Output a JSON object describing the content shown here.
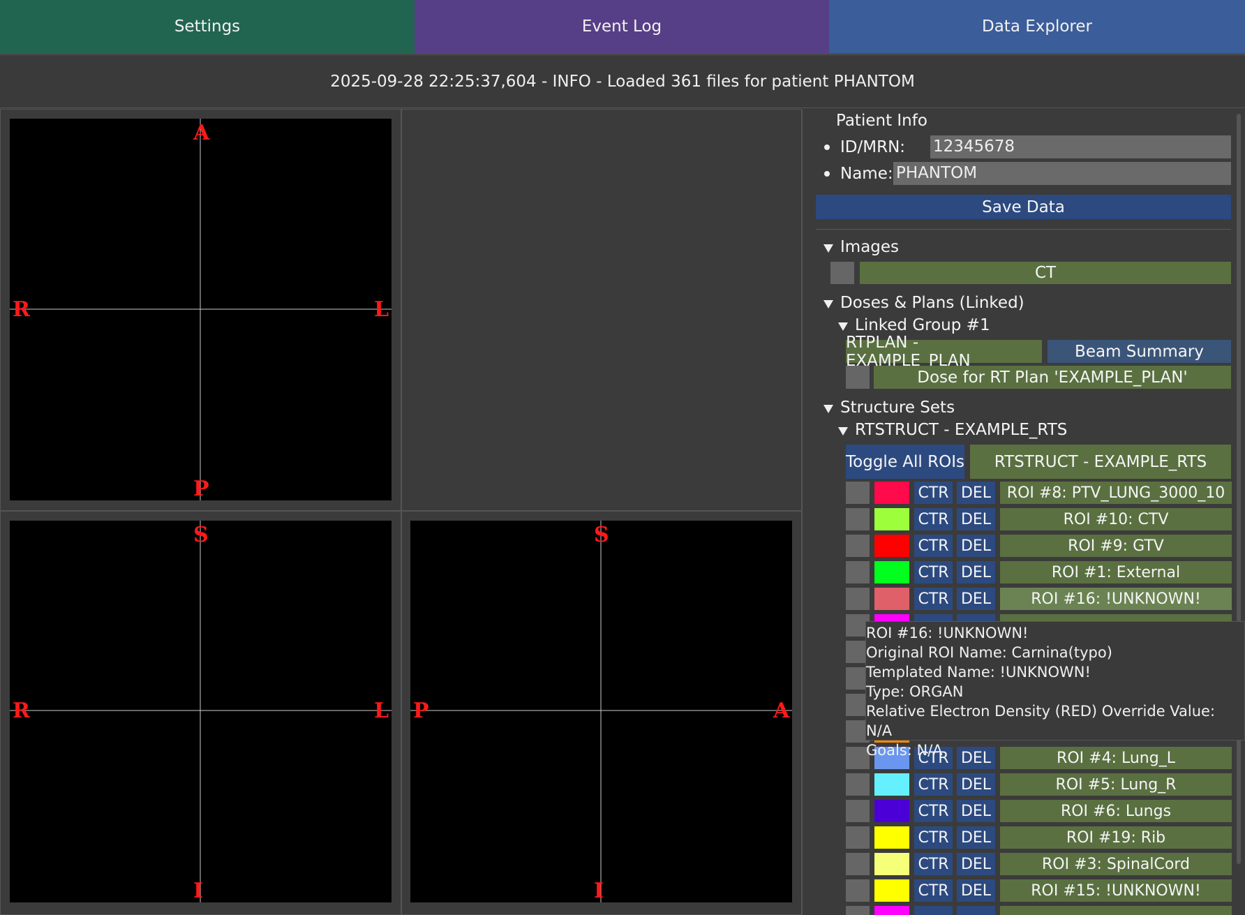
{
  "tabs": {
    "settings": "Settings",
    "event_log": "Event Log",
    "data_explorer": "Data Explorer"
  },
  "colors": {
    "settings_tab": "#216550",
    "event_log_tab": "#573f87",
    "data_explorer_tab": "#3b5d9a",
    "orientation_label": "#ff1a1a"
  },
  "log_message": "2025-09-28 22:25:37,604 - INFO - Loaded 361 files for patient PHANTOM",
  "views": {
    "axial": {
      "top": "A",
      "bottom": "P",
      "left": "R",
      "right": "L"
    },
    "coronal": {
      "top": "S",
      "bottom": "I",
      "left": "R",
      "right": "L"
    },
    "sagittal": {
      "top": "S",
      "bottom": "I",
      "left": "P",
      "right": "A"
    }
  },
  "patient_info": {
    "header": "Patient Info",
    "id_label": "ID/MRN:",
    "id_value": "12345678",
    "name_label": "Name:",
    "name_value": "PHANTOM",
    "save_button": "Save Data"
  },
  "images": {
    "header": "Images",
    "items": [
      "CT"
    ]
  },
  "doses_plans": {
    "header": "Doses & Plans (Linked)",
    "group_label": "Linked Group #1",
    "plan_button": "RTPLAN - EXAMPLE_PLAN",
    "beam_summary_button": "Beam Summary",
    "dose_button": "Dose for RT Plan 'EXAMPLE_PLAN'"
  },
  "structure_sets": {
    "header": "Structure Sets",
    "rtstruct_label": "RTSTRUCT - EXAMPLE_RTS",
    "toggle_all_button": "Toggle All ROIs",
    "rtstruct_button": "RTSTRUCT - EXAMPLE_RTS",
    "ctr_label": "CTR",
    "del_label": "DEL",
    "rois_top": [
      {
        "name": "ROI #8: PTV_LUNG_3000_10",
        "color": "#ff0a4a"
      },
      {
        "name": "ROI #10: CTV",
        "color": "#9dff3c"
      },
      {
        "name": "ROI #9: GTV",
        "color": "#ff0000"
      },
      {
        "name": "ROI #1: External",
        "color": "#00ff1e"
      },
      {
        "name": "ROI #16: !UNKNOWN!",
        "color": "#e0606a"
      }
    ],
    "rois_bottom": [
      {
        "name": "ROI #4: Lung_L",
        "color": "#6a96f0"
      },
      {
        "name": "ROI #5: Lung_R",
        "color": "#64f0ff"
      },
      {
        "name": "ROI #6: Lungs",
        "color": "#4a00d6"
      },
      {
        "name": "ROI #19: Rib",
        "color": "#ffff00"
      },
      {
        "name": "ROI #3: SpinalCord",
        "color": "#f5ff78"
      },
      {
        "name": "ROI #15: !UNKNOWN!",
        "color": "#ffff00"
      }
    ],
    "partial_swatch_colors": [
      "#ff00ff",
      "#ff8800",
      "#ff00ff"
    ]
  },
  "tooltip": {
    "lines": [
      "ROI #16: !UNKNOWN!",
      "Original ROI Name: Carnina(typo)",
      "Templated Name: !UNKNOWN!",
      "Type: ORGAN",
      "Relative Electron Density (RED) Override Value: N/A",
      "Goals: N/A"
    ]
  }
}
